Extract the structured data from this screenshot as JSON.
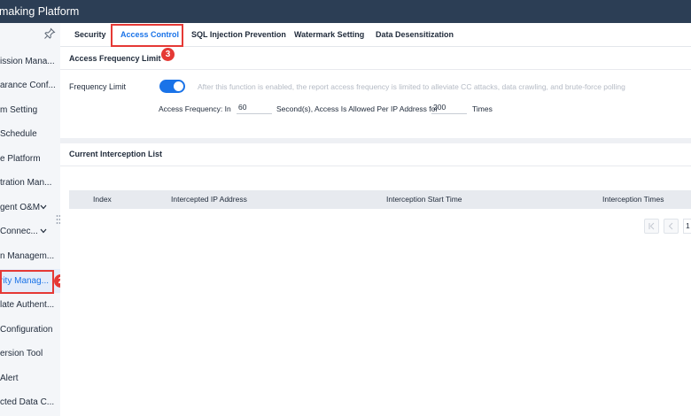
{
  "app": {
    "title": "making Platform"
  },
  "sidebar": {
    "items": [
      {
        "label": "ission Mana...",
        "chevron": false
      },
      {
        "label": "arance Conf...",
        "chevron": false
      },
      {
        "label": "m Setting",
        "chevron": false
      },
      {
        "label": "Schedule",
        "chevron": false
      },
      {
        "label": "e Platform",
        "chevron": false
      },
      {
        "label": "tration Man...",
        "chevron": false
      },
      {
        "label": "gent O&M",
        "chevron": true
      },
      {
        "label": "Connec...",
        "chevron": true
      },
      {
        "label": "n Managem...",
        "chevron": false
      },
      {
        "label": "rity Manag...",
        "chevron": false,
        "active": true
      },
      {
        "label": "late Authent...",
        "chevron": false
      },
      {
        "label": "Configuration",
        "chevron": false
      },
      {
        "label": "ersion Tool",
        "chevron": false
      },
      {
        "label": "Alert",
        "chevron": false
      },
      {
        "label": "cted Data C...",
        "chevron": false
      }
    ],
    "annotation_badge": "2"
  },
  "tabs": {
    "items": [
      {
        "label": "Security"
      },
      {
        "label": "Access Control",
        "active": true
      },
      {
        "label": "SQL Injection Prevention"
      },
      {
        "label": "Watermark Setting"
      },
      {
        "label": "Data Desensitization"
      }
    ],
    "annotation_badge": "3"
  },
  "access_frequency": {
    "section_title": "Access Frequency Limit",
    "frequency_label": "Frequency Limit",
    "toggle_on": true,
    "hint": "After this function is enabled, the report access frequency is limited to alleviate CC attacks, data crawling, and brute-force polling",
    "text_in": "Access Frequency: In",
    "seconds_value": "60",
    "text_mid": "Second(s), Access Is Allowed Per IP Address for",
    "times_value": "200",
    "text_times": "Times"
  },
  "interception": {
    "section_title": "Current Interception List",
    "columns": [
      "Index",
      "Intercepted IP Address",
      "Interception Start Time",
      "Interception Times"
    ]
  },
  "pagination": {
    "page": "1"
  },
  "colors": {
    "accent": "#1a73e8",
    "highlight": "#e53935",
    "topbar": "#2c3e55"
  }
}
